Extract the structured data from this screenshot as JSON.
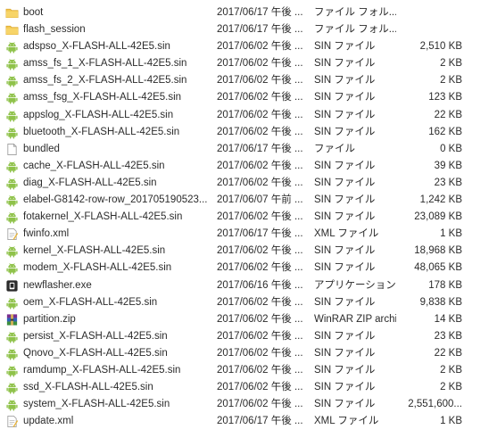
{
  "colors": {
    "folder": "#f3c64f",
    "android": "#8fc24a",
    "xml": "#e9b43a",
    "zip": "#7a2f8f"
  },
  "files": [
    {
      "name": "boot",
      "date": "2017/06/17 午後 ...",
      "type": "ファイル フォル...",
      "size": "",
      "icon": "folder-icon"
    },
    {
      "name": "flash_session",
      "date": "2017/06/17 午後 ...",
      "type": "ファイル フォル...",
      "size": "",
      "icon": "folder-icon"
    },
    {
      "name": "adspso_X-FLASH-ALL-42E5.sin",
      "date": "2017/06/02 午後 ...",
      "type": "SIN ファイル",
      "size": "2,510 KB",
      "icon": "android-icon"
    },
    {
      "name": "amss_fs_1_X-FLASH-ALL-42E5.sin",
      "date": "2017/06/02 午後 ...",
      "type": "SIN ファイル",
      "size": "2 KB",
      "icon": "android-icon"
    },
    {
      "name": "amss_fs_2_X-FLASH-ALL-42E5.sin",
      "date": "2017/06/02 午後 ...",
      "type": "SIN ファイル",
      "size": "2 KB",
      "icon": "android-icon"
    },
    {
      "name": "amss_fsg_X-FLASH-ALL-42E5.sin",
      "date": "2017/06/02 午後 ...",
      "type": "SIN ファイル",
      "size": "123 KB",
      "icon": "android-icon"
    },
    {
      "name": "appslog_X-FLASH-ALL-42E5.sin",
      "date": "2017/06/02 午後 ...",
      "type": "SIN ファイル",
      "size": "22 KB",
      "icon": "android-icon"
    },
    {
      "name": "bluetooth_X-FLASH-ALL-42E5.sin",
      "date": "2017/06/02 午後 ...",
      "type": "SIN ファイル",
      "size": "162 KB",
      "icon": "android-icon"
    },
    {
      "name": "bundled",
      "date": "2017/06/17 午後 ...",
      "type": "ファイル",
      "size": "0 KB",
      "icon": "blank-file-icon"
    },
    {
      "name": "cache_X-FLASH-ALL-42E5.sin",
      "date": "2017/06/02 午後 ...",
      "type": "SIN ファイル",
      "size": "39 KB",
      "icon": "android-icon"
    },
    {
      "name": "diag_X-FLASH-ALL-42E5.sin",
      "date": "2017/06/02 午後 ...",
      "type": "SIN ファイル",
      "size": "23 KB",
      "icon": "android-icon"
    },
    {
      "name": "elabel-G8142-row-row_201705190523...",
      "date": "2017/06/07 午前 ...",
      "type": "SIN ファイル",
      "size": "1,242 KB",
      "icon": "android-icon"
    },
    {
      "name": "fotakernel_X-FLASH-ALL-42E5.sin",
      "date": "2017/06/02 午後 ...",
      "type": "SIN ファイル",
      "size": "23,089 KB",
      "icon": "android-icon"
    },
    {
      "name": "fwinfo.xml",
      "date": "2017/06/17 午後 ...",
      "type": "XML ファイル",
      "size": "1 KB",
      "icon": "xml-file-icon"
    },
    {
      "name": "kernel_X-FLASH-ALL-42E5.sin",
      "date": "2017/06/02 午後 ...",
      "type": "SIN ファイル",
      "size": "18,968 KB",
      "icon": "android-icon"
    },
    {
      "name": "modem_X-FLASH-ALL-42E5.sin",
      "date": "2017/06/02 午後 ...",
      "type": "SIN ファイル",
      "size": "48,065 KB",
      "icon": "android-icon"
    },
    {
      "name": "newflasher.exe",
      "date": "2017/06/16 午後 ...",
      "type": "アプリケーション",
      "size": "178 KB",
      "icon": "exe-icon"
    },
    {
      "name": "oem_X-FLASH-ALL-42E5.sin",
      "date": "2017/06/02 午後 ...",
      "type": "SIN ファイル",
      "size": "9,838 KB",
      "icon": "android-icon"
    },
    {
      "name": "partition.zip",
      "date": "2017/06/02 午後 ...",
      "type": "WinRAR ZIP archi...",
      "size": "14 KB",
      "icon": "zip-icon"
    },
    {
      "name": "persist_X-FLASH-ALL-42E5.sin",
      "date": "2017/06/02 午後 ...",
      "type": "SIN ファイル",
      "size": "23 KB",
      "icon": "android-icon"
    },
    {
      "name": "Qnovo_X-FLASH-ALL-42E5.sin",
      "date": "2017/06/02 午後 ...",
      "type": "SIN ファイル",
      "size": "22 KB",
      "icon": "android-icon"
    },
    {
      "name": "ramdump_X-FLASH-ALL-42E5.sin",
      "date": "2017/06/02 午後 ...",
      "type": "SIN ファイル",
      "size": "2 KB",
      "icon": "android-icon"
    },
    {
      "name": "ssd_X-FLASH-ALL-42E5.sin",
      "date": "2017/06/02 午後 ...",
      "type": "SIN ファイル",
      "size": "2 KB",
      "icon": "android-icon"
    },
    {
      "name": "system_X-FLASH-ALL-42E5.sin",
      "date": "2017/06/02 午後 ...",
      "type": "SIN ファイル",
      "size": "2,551,600...",
      "icon": "android-icon"
    },
    {
      "name": "update.xml",
      "date": "2017/06/17 午後 ...",
      "type": "XML ファイル",
      "size": "1 KB",
      "icon": "xml-file-icon"
    }
  ]
}
